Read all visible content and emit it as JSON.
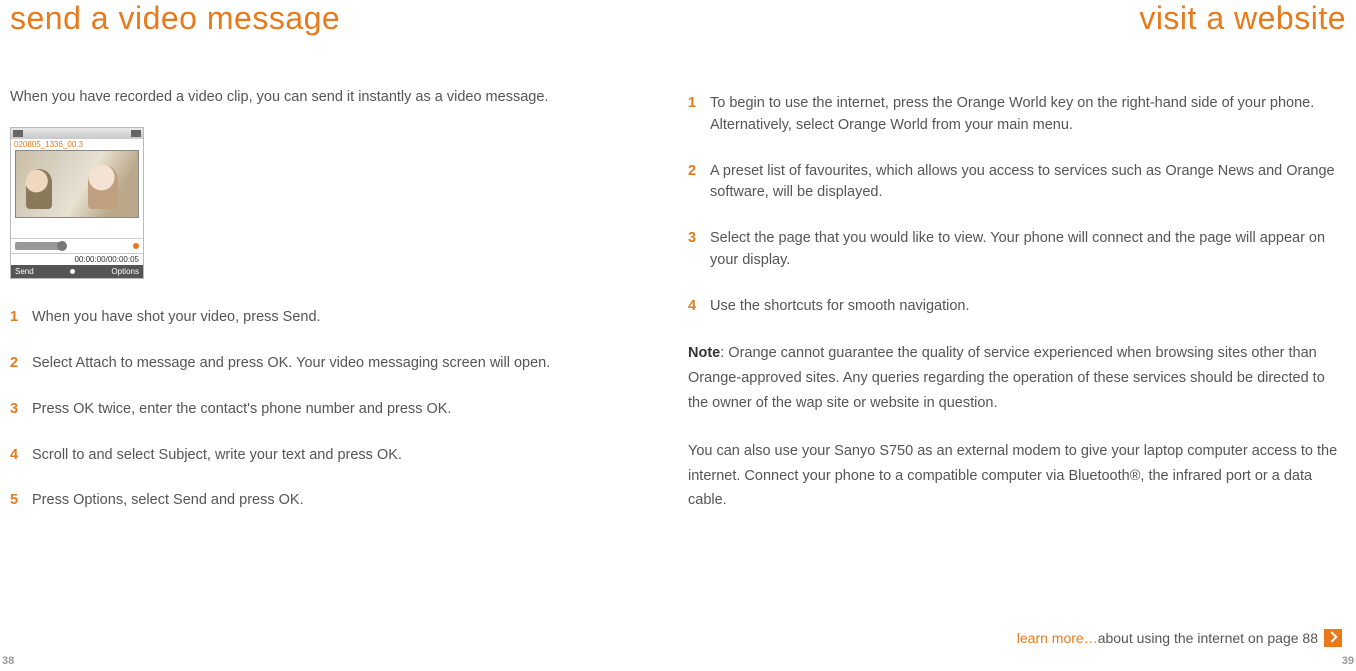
{
  "left": {
    "title": "send a video message",
    "intro": "When you have recorded a video clip, you can send it instantly as a video message.",
    "phone": {
      "clip_name": "020805_1336_00.3",
      "time": "00:00:00/00:00:05",
      "softleft": "Send",
      "softright": "Options"
    },
    "steps": [
      "When you have shot your video, press Send.",
      "Select Attach to message and press OK. Your video messaging screen will open.",
      "Press OK twice, enter the contact's phone number and press OK.",
      "Scroll to and select Subject, write your text and press OK.",
      "Press Options, select Send and press OK."
    ],
    "pagenum": "38"
  },
  "right": {
    "title": "visit a website",
    "steps": [
      "To begin to use the internet, press the Orange World key on the right-hand side of your phone. Alternatively, select Orange World from your main menu.",
      "A preset list of favourites, which allows you access to services such as Orange News and Orange software, will be displayed.",
      "Select the page that you would like to view. Your phone will connect and the page will appear on your display.",
      "Use the shortcuts for smooth navigation."
    ],
    "note_label": "Note",
    "note": ": Orange cannot guarantee the quality of service experienced when browsing sites other than Orange-approved sites. Any queries regarding the operation of these services should be directed to the owner of the wap site or website in question.",
    "extra": "You can also use your Sanyo S750 as an external modem to give your laptop computer access to the internet. Connect your phone to a compatible computer via Bluetooth®, the infrared port or a data cable.",
    "learnmore_prefix": "learn more…",
    "learnmore_rest": " about using the internet on page 88",
    "pagenum": "39"
  }
}
